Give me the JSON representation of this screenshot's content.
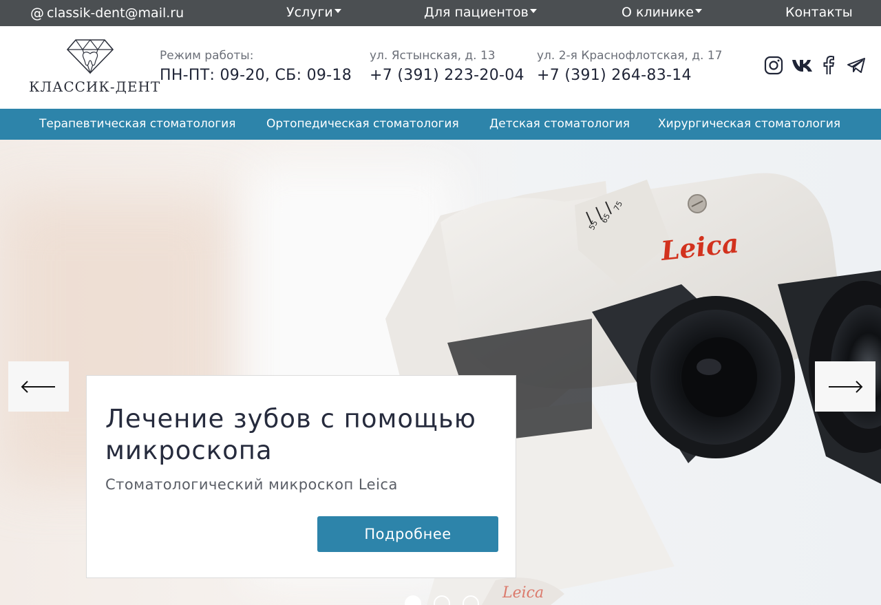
{
  "topbar": {
    "email": "classik-dent@mail.ru",
    "menu": [
      {
        "label": "Услуги"
      },
      {
        "label": "Для пациентов"
      },
      {
        "label": "О клинике"
      },
      {
        "label": "Контакты"
      }
    ]
  },
  "header": {
    "logo_text": "КЛАССИК-ДЕНТ",
    "hours": {
      "label": "Режим работы:",
      "value": "ПН-ПТ: 09-20, СБ: 09-18"
    },
    "branch1": {
      "address": "ул. Ястынская, д. 13",
      "phone": "+7 (391) 223-20-04"
    },
    "branch2": {
      "address": "ул. 2-я Краснофлотская, д. 17",
      "phone": "+7 (391) 264-83-14"
    },
    "social": [
      "instagram-icon",
      "vk-icon",
      "facebook-icon",
      "telegram-icon"
    ]
  },
  "nav": {
    "items": [
      {
        "label": "Терапевтическая стоматология"
      },
      {
        "label": "Ортопедическая стоматология"
      },
      {
        "label": "Детская стоматология"
      },
      {
        "label": "Хирургическая стоматология"
      }
    ]
  },
  "hero": {
    "title": "Лечение зубов с помощью микроскопа",
    "subtitle": "Стоматологический микроскоп Leica",
    "button_label": "Подробнее",
    "brand_mark": "Leica",
    "scale_marks": [
      "55",
      "65",
      "75"
    ],
    "slides_total": 3,
    "active_slide": 1
  },
  "colors": {
    "topbar_bg": "#4b4f52",
    "accent": "#2d84aa",
    "text_dark": "#1f2436",
    "leica_red": "#d2321e"
  }
}
